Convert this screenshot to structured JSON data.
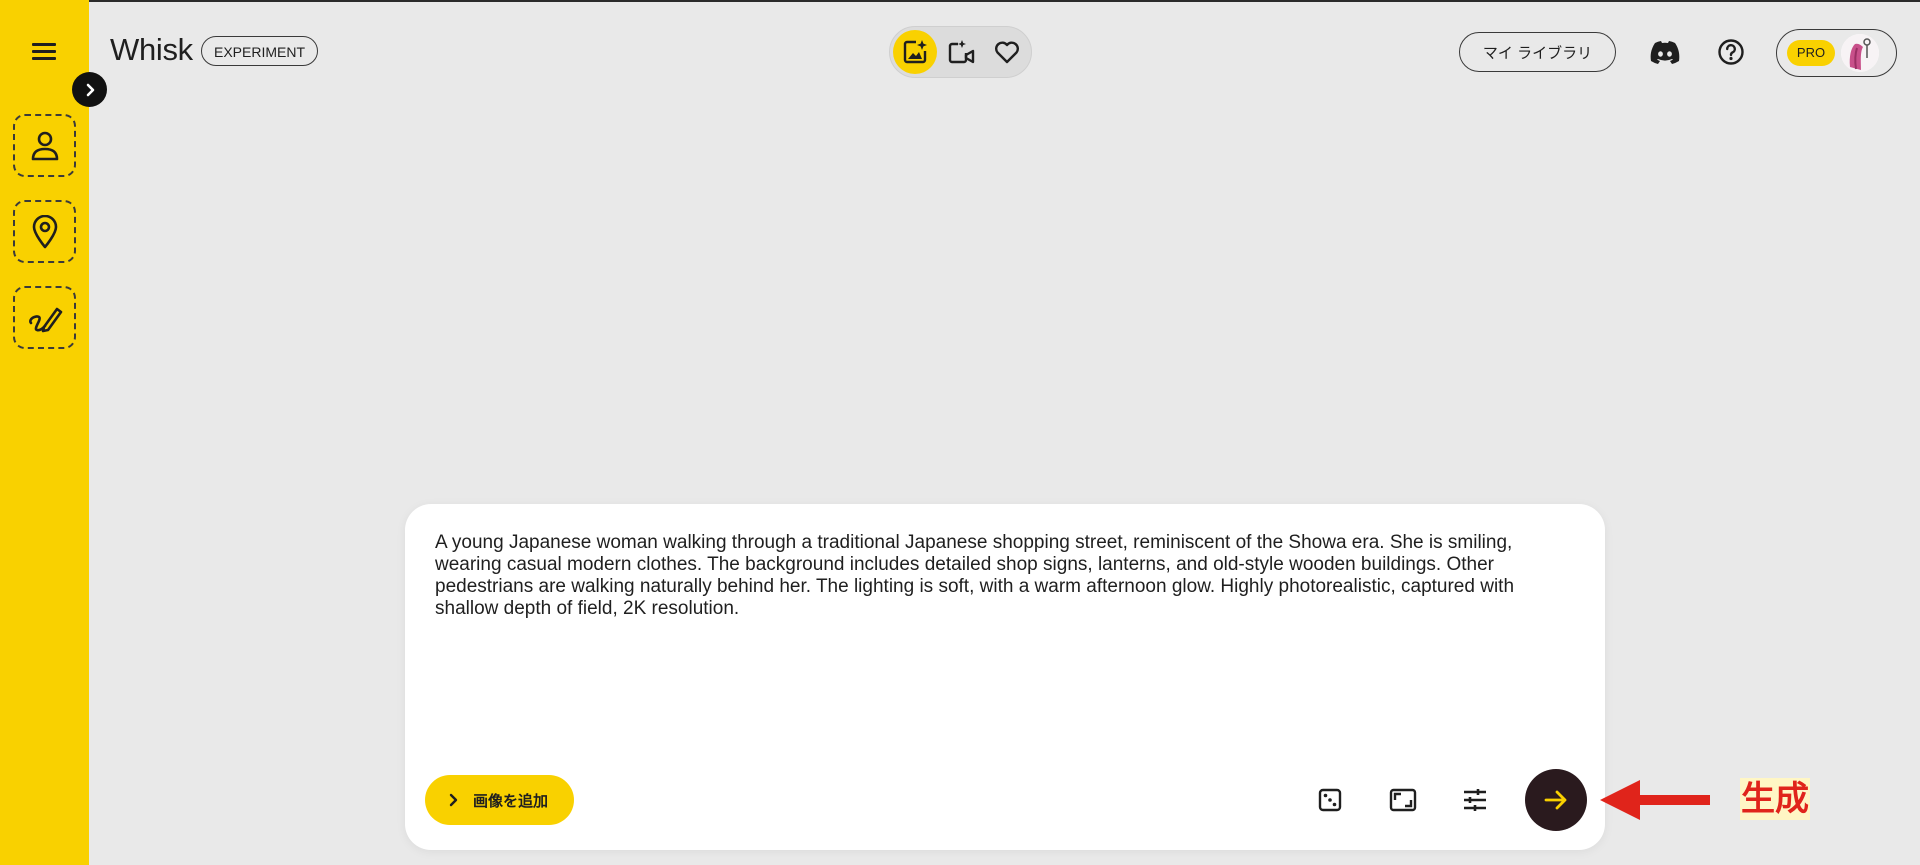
{
  "app": {
    "title": "Whisk",
    "badge": "EXPERIMENT"
  },
  "header": {
    "modes": [
      {
        "name": "image-mode",
        "icon": "image-sparkle-icon",
        "active": true
      },
      {
        "name": "video-mode",
        "icon": "video-sparkle-icon",
        "active": false
      },
      {
        "name": "favorites",
        "icon": "heart-icon",
        "active": false
      }
    ],
    "library_label": "マイ ライブラリ",
    "discord_icon": "discord-icon",
    "help_icon": "help-icon",
    "plan_badge": "PRO"
  },
  "sidebar": {
    "slots": [
      {
        "name": "subject",
        "icon": "person-icon"
      },
      {
        "name": "scene",
        "icon": "location-pin-icon"
      },
      {
        "name": "style",
        "icon": "brush-icon"
      }
    ]
  },
  "prompt": {
    "value": "A young Japanese woman walking through a traditional Japanese shopping street, reminiscent of the Showa era. She is smiling, wearing casual modern clothes. The background includes detailed shop signs, lanterns, and old-style wooden buildings. Other pedestrians are walking naturally behind her. The lighting is soft, with a warm afternoon glow. Highly photorealistic, captured with shallow depth of field, 2K resolution."
  },
  "toolbar": {
    "add_image_label": "画像を追加",
    "tools": [
      "dice-icon",
      "aspect-ratio-icon",
      "tune-icon"
    ],
    "submit_icon": "arrow-right-icon"
  },
  "annotation": {
    "label": "生成",
    "color": "#e0241b"
  },
  "colors": {
    "accent": "#f9d100",
    "background": "#e9e9e9",
    "submit": "#2a1a1e"
  }
}
